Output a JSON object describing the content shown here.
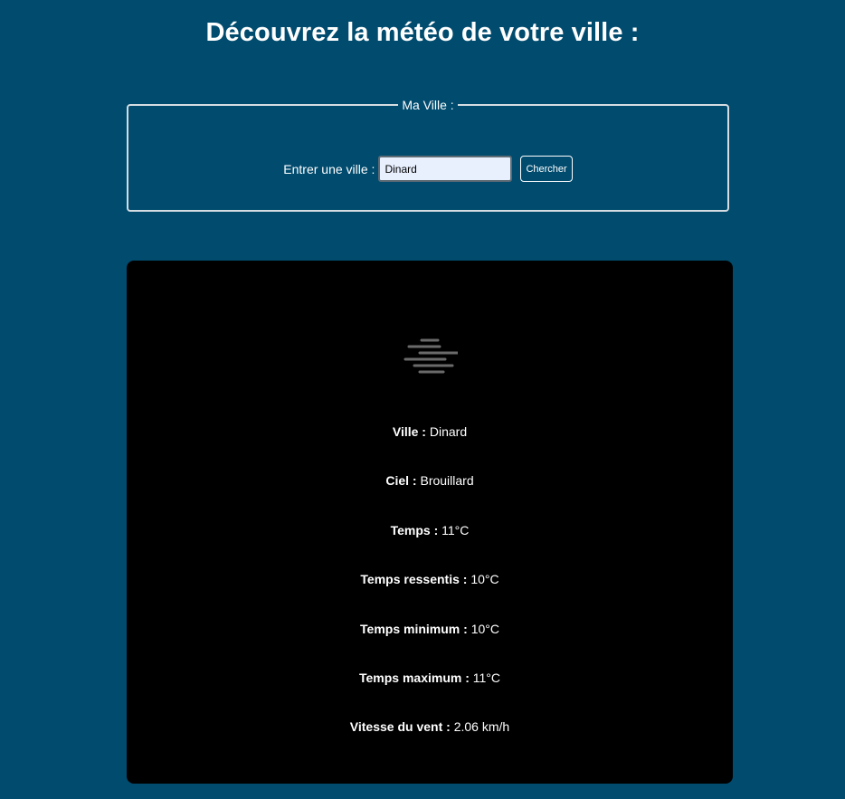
{
  "page": {
    "title": "Découvrez la météo de votre ville :"
  },
  "search": {
    "legend": "Ma Ville :",
    "label": "Entrer une ville :",
    "value": "Dinard",
    "button_label": "Chercher"
  },
  "weather": {
    "icon": "fog-icon",
    "items": [
      {
        "label": "Ville :",
        "value": "Dinard"
      },
      {
        "label": "Ciel :",
        "value": "Brouillard"
      },
      {
        "label": "Temps :",
        "value": "11°C"
      },
      {
        "label": "Temps ressentis :",
        "value": "10°C"
      },
      {
        "label": "Temps minimum :",
        "value": "10°C"
      },
      {
        "label": "Temps maximum :",
        "value": "11°C"
      },
      {
        "label": "Vitesse du vent :",
        "value": "2.06 km/h"
      }
    ]
  },
  "colors": {
    "background": "#004b6e",
    "card": "#000000",
    "input_background": "#e8f0fe"
  }
}
